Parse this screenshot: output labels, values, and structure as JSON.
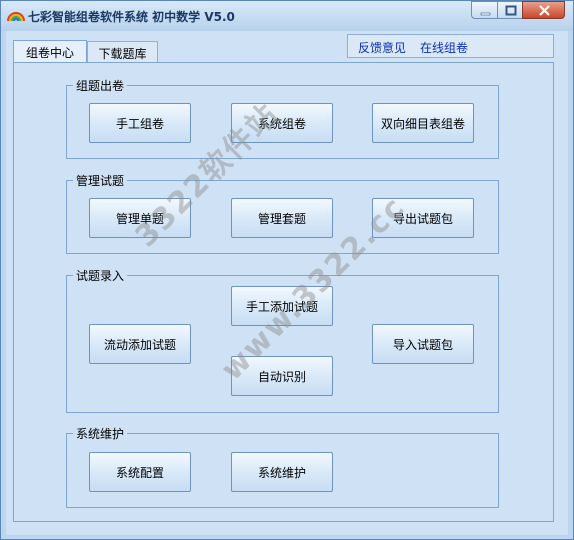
{
  "window": {
    "title": "七彩智能组卷软件系统 初中数学 V5.0"
  },
  "tabs": [
    {
      "label": "组卷中心",
      "active": true
    },
    {
      "label": "下载题库",
      "active": false
    }
  ],
  "links": {
    "feedback": "反馈意见",
    "online": "在线组卷"
  },
  "groups": {
    "compose": {
      "label": "组题出卷",
      "buttons": [
        "手工组卷",
        "系统组卷",
        "双向细目表组卷"
      ]
    },
    "manage": {
      "label": "管理试题",
      "buttons": [
        "管理单题",
        "管理套题",
        "导出试题包"
      ]
    },
    "entry": {
      "label": "试题录入",
      "buttons": [
        "手工添加试题",
        "流动添加试题",
        "导入试题包",
        "自动识别"
      ]
    },
    "maintain": {
      "label": "系统维护",
      "buttons": [
        "系统配置",
        "系统维护"
      ]
    }
  },
  "watermarks": [
    "3322软件站",
    "www.3322.cc"
  ],
  "colors": {
    "background": "#cfe2f5",
    "link": "#0a2fb6",
    "border": "#7ea6d0"
  }
}
